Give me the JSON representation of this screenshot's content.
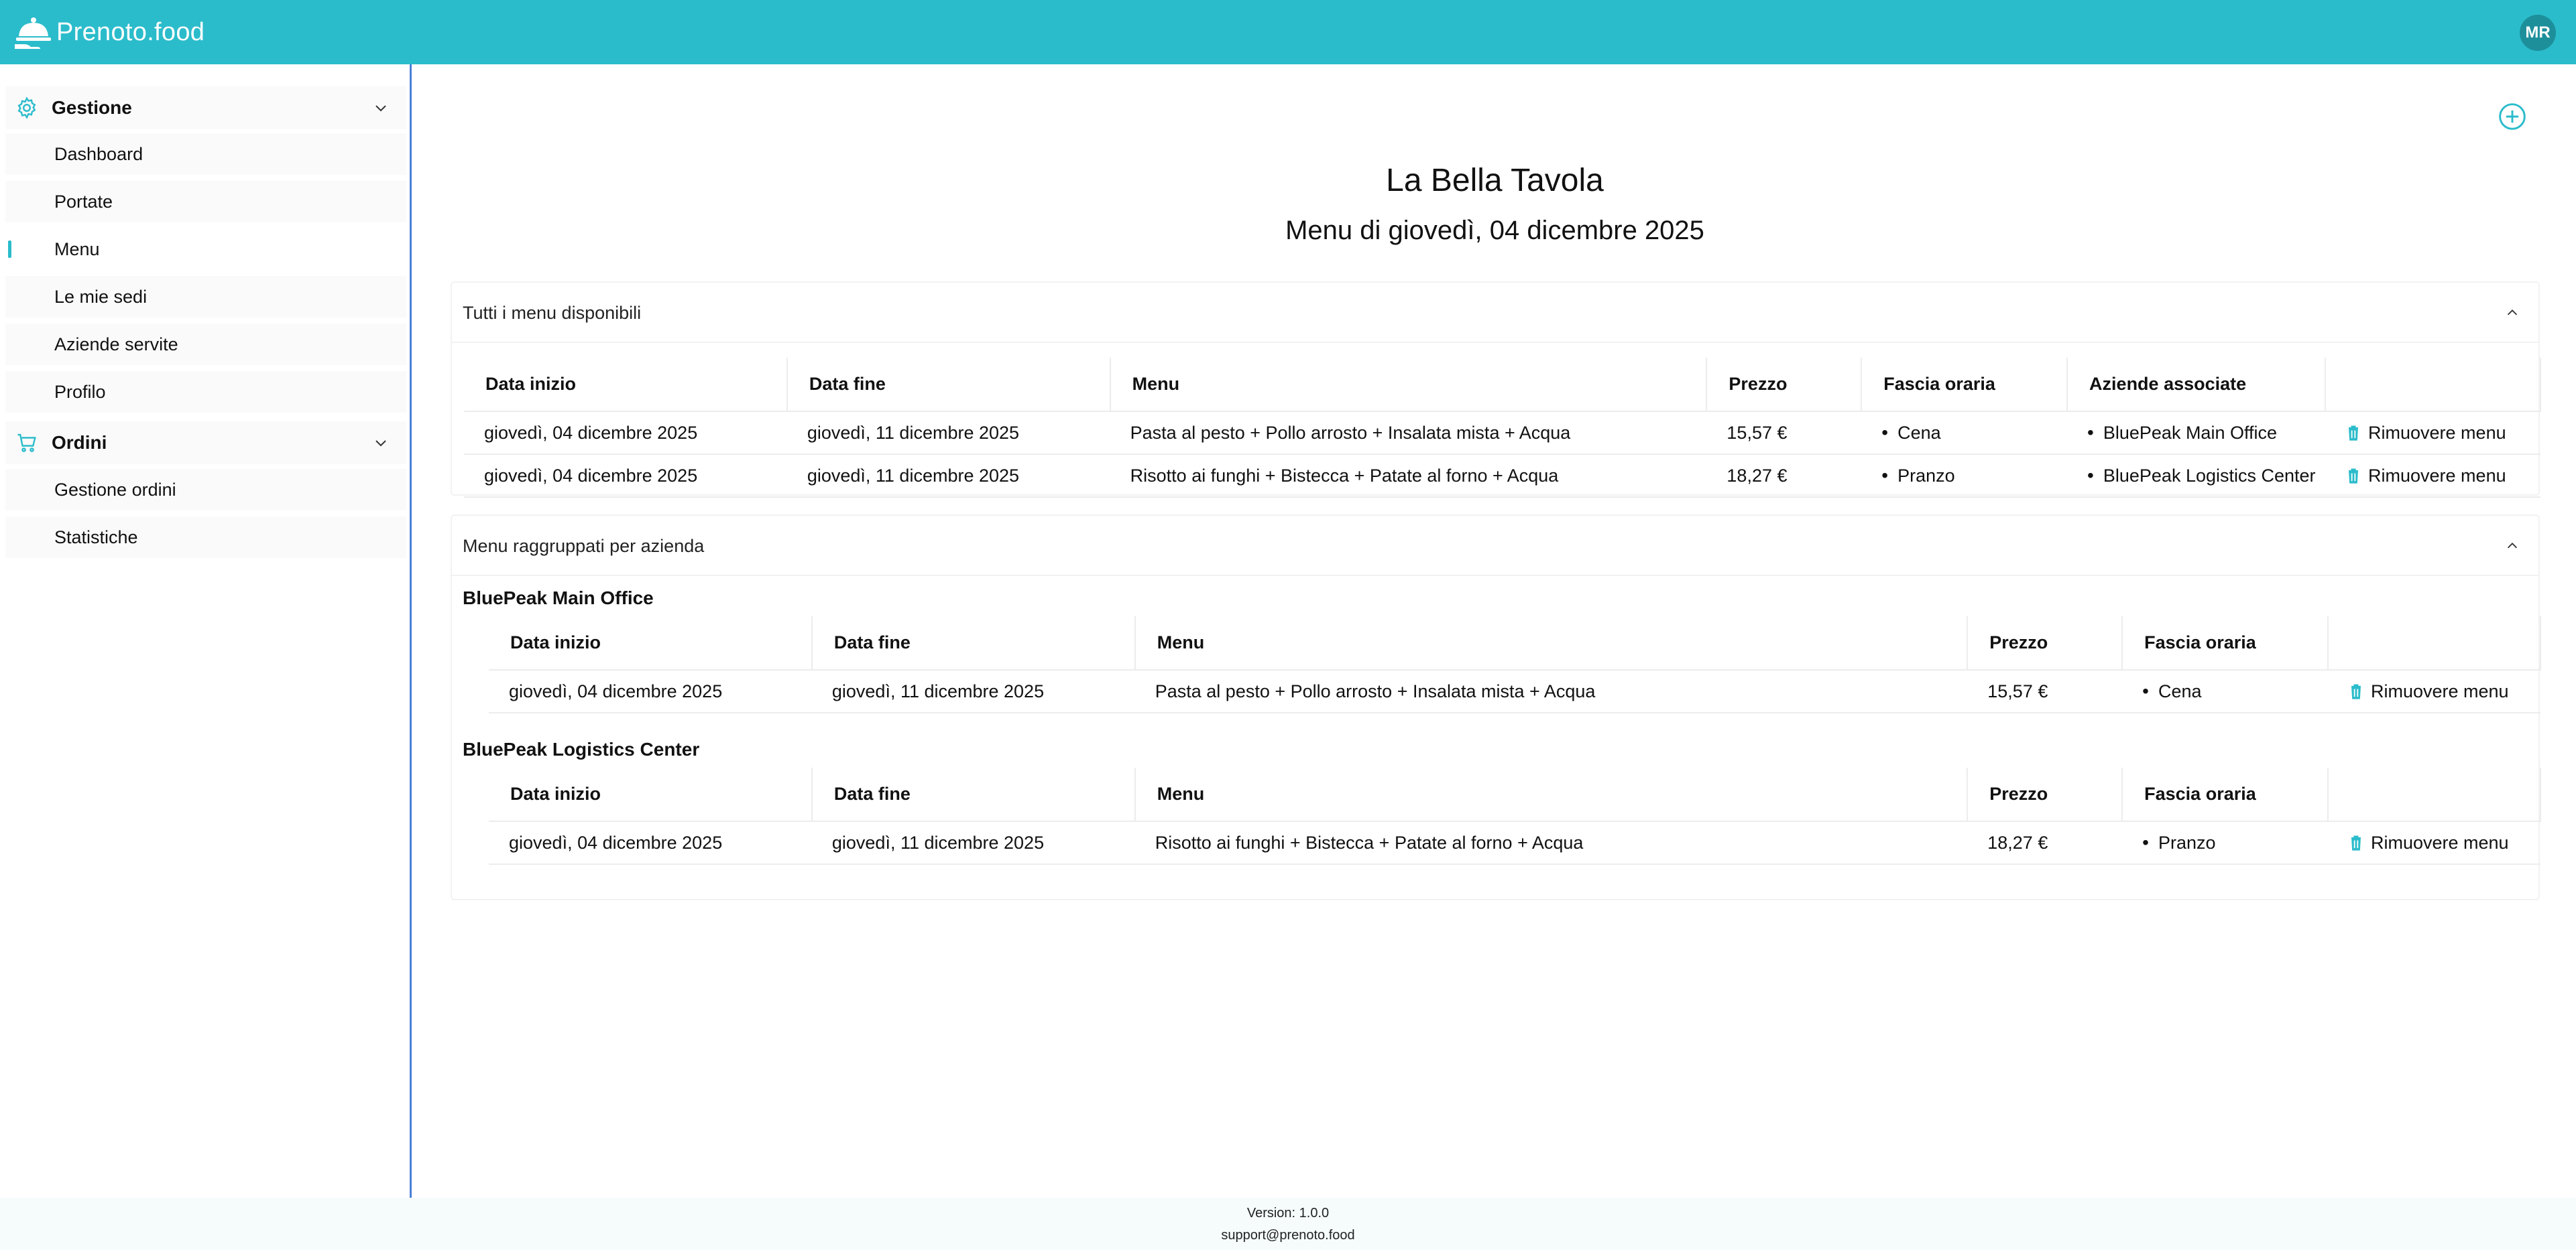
{
  "app": {
    "name": "Prenoto.food",
    "user_initials": "MR"
  },
  "sidebar": {
    "groups": [
      {
        "label": "Gestione",
        "icon": "gear-icon",
        "items": [
          {
            "label": "Dashboard",
            "active": false
          },
          {
            "label": "Portate",
            "active": false
          },
          {
            "label": "Menu",
            "active": true
          },
          {
            "label": "Le mie sedi",
            "active": false
          },
          {
            "label": "Aziende servite",
            "active": false
          },
          {
            "label": "Profilo",
            "active": false
          }
        ]
      },
      {
        "label": "Ordini",
        "icon": "cart-icon",
        "items": [
          {
            "label": "Gestione ordini",
            "active": false
          },
          {
            "label": "Statistiche",
            "active": false
          }
        ]
      }
    ]
  },
  "main": {
    "restaurant_name": "La Bella Tavola",
    "menu_date_title": "Menu di giovedì, 04 dicembre 2025",
    "all_menus": {
      "title": "Tutti i menu disponibili",
      "columns": [
        "Data inizio",
        "Data fine",
        "Menu",
        "Prezzo",
        "Fascia oraria",
        "Aziende associate",
        ""
      ],
      "rows": [
        {
          "start": "giovedì, 04 dicembre 2025",
          "end": "giovedì, 11 dicembre 2025",
          "menu": "Pasta al pesto + Pollo arrosto + Insalata mista + Acqua",
          "price": "15,57 €",
          "slot": "Cena",
          "company": "BluePeak Main Office",
          "action": "Rimuovere menu"
        },
        {
          "start": "giovedì, 04 dicembre 2025",
          "end": "giovedì, 11 dicembre 2025",
          "menu": "Risotto ai funghi + Bistecca + Patate al forno + Acqua",
          "price": "18,27 €",
          "slot": "Pranzo",
          "company": "BluePeak Logistics Center",
          "action": "Rimuovere menu"
        }
      ]
    },
    "grouped": {
      "title": "Menu raggruppati per azienda",
      "columns": [
        "Data inizio",
        "Data fine",
        "Menu",
        "Prezzo",
        "Fascia oraria",
        ""
      ],
      "companies": [
        {
          "name": "BluePeak Main Office",
          "rows": [
            {
              "start": "giovedì, 04 dicembre 2025",
              "end": "giovedì, 11 dicembre 2025",
              "menu": "Pasta al pesto + Pollo arrosto + Insalata mista + Acqua",
              "price": "15,57 €",
              "slot": "Cena",
              "action": "Rimuovere menu"
            }
          ]
        },
        {
          "name": "BluePeak Logistics Center",
          "rows": [
            {
              "start": "giovedì, 04 dicembre 2025",
              "end": "giovedì, 11 dicembre 2025",
              "menu": "Risotto ai funghi + Bistecca + Patate al forno + Acqua",
              "price": "18,27 €",
              "slot": "Pranzo",
              "action": "Rimuovere menu"
            }
          ]
        }
      ]
    }
  },
  "footer": {
    "version": "Version: 1.0.0",
    "support": "support@prenoto.food"
  },
  "colors": {
    "brand": "#2bbccb",
    "avatar": "#1d8f9b",
    "sidebar_border": "#4a7fd8"
  }
}
